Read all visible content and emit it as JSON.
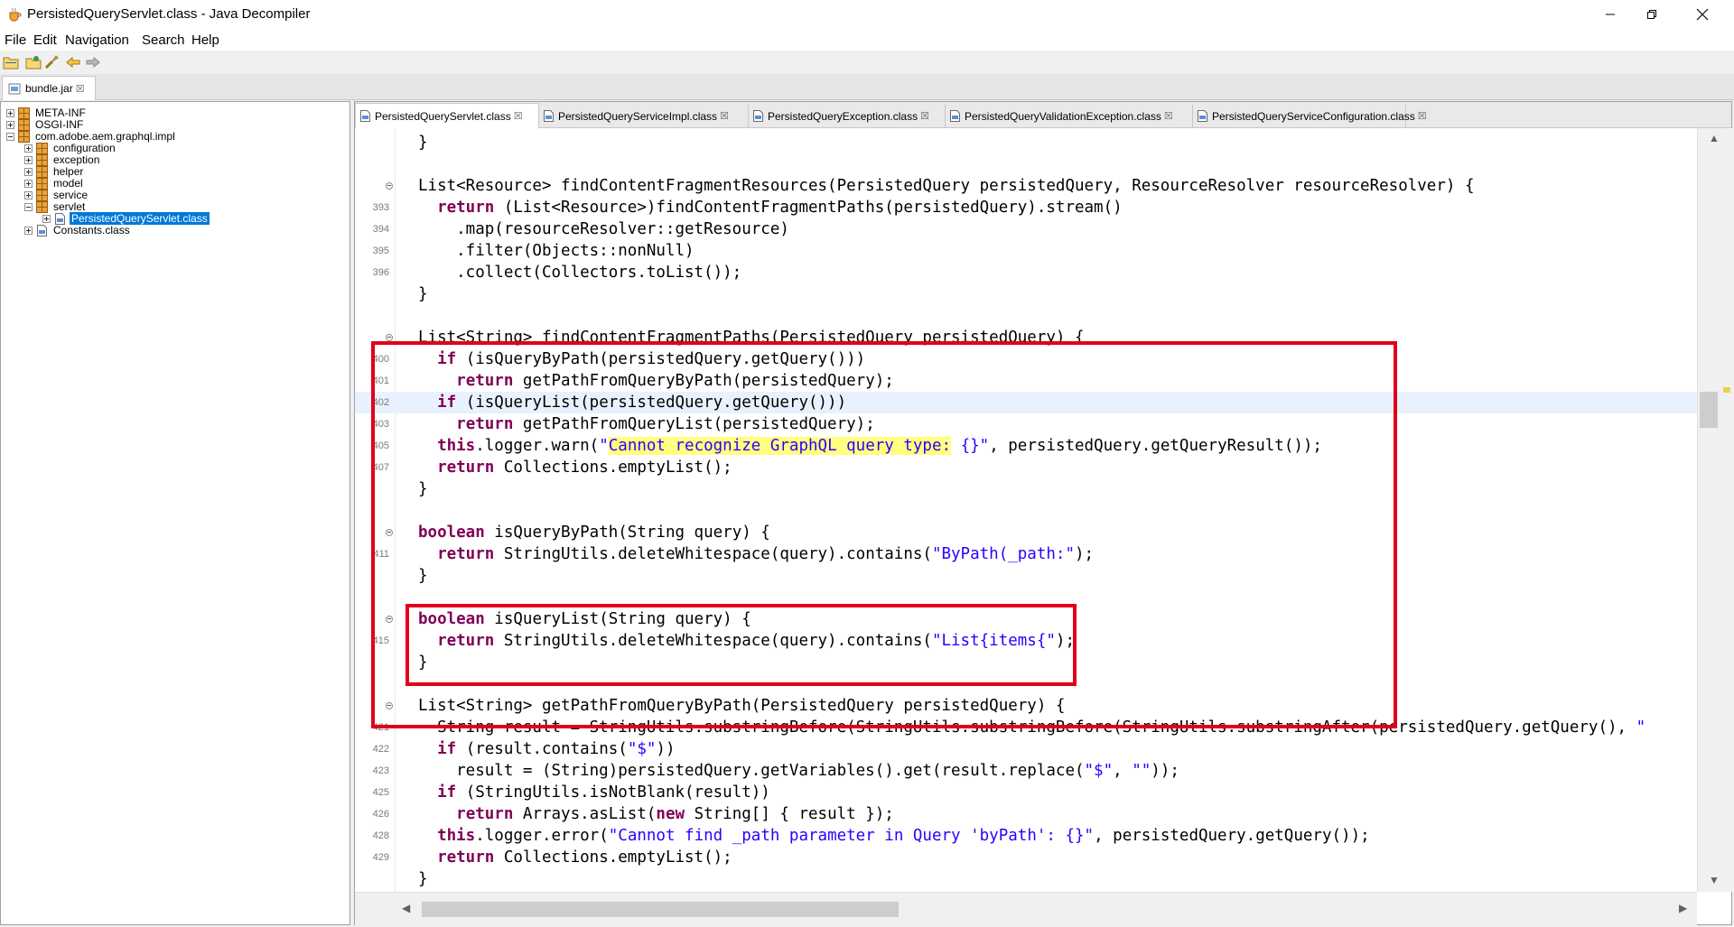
{
  "window": {
    "title": "PersistedQueryServlet.class - Java Decompiler",
    "controls": [
      "minimize",
      "restore",
      "close"
    ]
  },
  "menu": [
    "File",
    "Edit",
    "Navigation",
    "Search",
    "Help"
  ],
  "toolbar": [
    "open-file-icon",
    "open-type-icon",
    "search-icon",
    "back-icon",
    "forward-icon"
  ],
  "jar_tab": {
    "label": "bundle.jar",
    "close": "☒"
  },
  "tree": {
    "nodes": [
      {
        "label": "META-INF",
        "depth": 0,
        "icon": "package-icon",
        "expander": "plus",
        "selected": false
      },
      {
        "label": "OSGI-INF",
        "depth": 0,
        "icon": "package-icon",
        "expander": "plus",
        "selected": false
      },
      {
        "label": "com.adobe.aem.graphql.impl",
        "depth": 0,
        "icon": "package-icon",
        "expander": "minus",
        "selected": false
      },
      {
        "label": "configuration",
        "depth": 1,
        "icon": "package-icon",
        "expander": "plus",
        "selected": false
      },
      {
        "label": "exception",
        "depth": 1,
        "icon": "package-icon",
        "expander": "plus",
        "selected": false
      },
      {
        "label": "helper",
        "depth": 1,
        "icon": "package-icon",
        "expander": "plus",
        "selected": false
      },
      {
        "label": "model",
        "depth": 1,
        "icon": "package-icon",
        "expander": "plus",
        "selected": false
      },
      {
        "label": "service",
        "depth": 1,
        "icon": "package-icon",
        "expander": "plus",
        "selected": false
      },
      {
        "label": "servlet",
        "depth": 1,
        "icon": "package-icon",
        "expander": "minus",
        "selected": false
      },
      {
        "label": "PersistedQueryServlet.class",
        "depth": 2,
        "icon": "class-file-icon",
        "expander": "plus",
        "selected": true
      },
      {
        "label": "Constants.class",
        "depth": 1,
        "icon": "class-file-icon",
        "expander": "plus",
        "selected": false
      }
    ]
  },
  "editor_tabs": [
    {
      "label": "PersistedQueryServlet.class",
      "active": true
    },
    {
      "label": "PersistedQueryServiceImpl.class",
      "active": false
    },
    {
      "label": "PersistedQueryException.class",
      "active": false
    },
    {
      "label": "PersistedQueryValidationException.class",
      "active": false
    },
    {
      "label": "PersistedQueryServiceConfiguration.class",
      "active": false
    }
  ],
  "tab_close": "☒",
  "code": [
    {
      "n": "",
      "fold": false,
      "hl": false,
      "segs": [
        [
          "p",
          "}"
        ]
      ]
    },
    {
      "n": "",
      "fold": false,
      "hl": false,
      "segs": [
        [
          "p",
          ""
        ]
      ]
    },
    {
      "n": "",
      "fold": true,
      "hl": false,
      "segs": [
        [
          "p",
          "List<Resource> findContentFragmentResources(PersistedQuery persistedQuery, ResourceResolver resourceResolver) {"
        ]
      ]
    },
    {
      "n": "393",
      "fold": false,
      "hl": false,
      "segs": [
        [
          "p",
          "  "
        ],
        [
          "k",
          "return"
        ],
        [
          "p",
          " (List<Resource>)findContentFragmentPaths(persistedQuery).stream()"
        ]
      ]
    },
    {
      "n": "394",
      "fold": false,
      "hl": false,
      "segs": [
        [
          "p",
          "    .map(resourceResolver::getResource)"
        ]
      ]
    },
    {
      "n": "395",
      "fold": false,
      "hl": false,
      "segs": [
        [
          "p",
          "    .filter(Objects::nonNull)"
        ]
      ]
    },
    {
      "n": "396",
      "fold": false,
      "hl": false,
      "segs": [
        [
          "p",
          "    .collect(Collectors.toList());"
        ]
      ]
    },
    {
      "n": "",
      "fold": false,
      "hl": false,
      "segs": [
        [
          "p",
          "}"
        ]
      ]
    },
    {
      "n": "",
      "fold": false,
      "hl": false,
      "segs": [
        [
          "p",
          ""
        ]
      ]
    },
    {
      "n": "",
      "fold": true,
      "hl": false,
      "segs": [
        [
          "p",
          "List<String> findContentFragmentPaths(PersistedQuery persistedQuery) {"
        ]
      ]
    },
    {
      "n": "400",
      "fold": false,
      "hl": false,
      "segs": [
        [
          "p",
          "  "
        ],
        [
          "k",
          "if"
        ],
        [
          "p",
          " (isQueryByPath(persistedQuery.getQuery()))"
        ]
      ]
    },
    {
      "n": "401",
      "fold": false,
      "hl": false,
      "segs": [
        [
          "p",
          "    "
        ],
        [
          "k",
          "return"
        ],
        [
          "p",
          " getPathFromQueryByPath(persistedQuery);"
        ]
      ]
    },
    {
      "n": "402",
      "fold": false,
      "hl": true,
      "segs": [
        [
          "p",
          "  "
        ],
        [
          "k",
          "if"
        ],
        [
          "p",
          " (isQueryList(persistedQuery.getQuery()))"
        ]
      ]
    },
    {
      "n": "403",
      "fold": false,
      "hl": false,
      "segs": [
        [
          "p",
          "    "
        ],
        [
          "k",
          "return"
        ],
        [
          "p",
          " getPathFromQueryList(persistedQuery);"
        ]
      ]
    },
    {
      "n": "405",
      "fold": false,
      "hl": false,
      "segs": [
        [
          "p",
          "  "
        ],
        [
          "k",
          "this"
        ],
        [
          "p",
          ".logger.warn("
        ],
        [
          "s",
          "\""
        ],
        [
          "y",
          "Cannot recognize GraphQL query type:"
        ],
        [
          "s",
          " {}\""
        ],
        [
          "p",
          ", persistedQuery.getQueryResult());"
        ]
      ]
    },
    {
      "n": "407",
      "fold": false,
      "hl": false,
      "segs": [
        [
          "p",
          "  "
        ],
        [
          "k",
          "return"
        ],
        [
          "p",
          " Collections.emptyList();"
        ]
      ]
    },
    {
      "n": "",
      "fold": false,
      "hl": false,
      "segs": [
        [
          "p",
          "}"
        ]
      ]
    },
    {
      "n": "",
      "fold": false,
      "hl": false,
      "segs": [
        [
          "p",
          ""
        ]
      ]
    },
    {
      "n": "",
      "fold": true,
      "hl": false,
      "segs": [
        [
          "k",
          "boolean"
        ],
        [
          "p",
          " isQueryByPath(String query) {"
        ]
      ]
    },
    {
      "n": "411",
      "fold": false,
      "hl": false,
      "segs": [
        [
          "p",
          "  "
        ],
        [
          "k",
          "return"
        ],
        [
          "p",
          " StringUtils.deleteWhitespace(query).contains("
        ],
        [
          "s",
          "\"ByPath(_path:\""
        ],
        [
          "p",
          ");"
        ]
      ]
    },
    {
      "n": "",
      "fold": false,
      "hl": false,
      "segs": [
        [
          "p",
          "}"
        ]
      ]
    },
    {
      "n": "",
      "fold": false,
      "hl": false,
      "segs": [
        [
          "p",
          ""
        ]
      ]
    },
    {
      "n": "",
      "fold": true,
      "hl": false,
      "segs": [
        [
          "k",
          "boolean"
        ],
        [
          "p",
          " isQueryList(String query) {"
        ]
      ]
    },
    {
      "n": "415",
      "fold": false,
      "hl": false,
      "segs": [
        [
          "p",
          "  "
        ],
        [
          "k",
          "return"
        ],
        [
          "p",
          " StringUtils.deleteWhitespace(query).contains("
        ],
        [
          "s",
          "\"List{items{\""
        ],
        [
          "p",
          ");"
        ]
      ]
    },
    {
      "n": "",
      "fold": false,
      "hl": false,
      "segs": [
        [
          "p",
          "}"
        ]
      ]
    },
    {
      "n": "",
      "fold": false,
      "hl": false,
      "segs": [
        [
          "p",
          ""
        ]
      ]
    },
    {
      "n": "",
      "fold": true,
      "hl": false,
      "segs": [
        [
          "p",
          "List<String> getPathFromQueryByPath(PersistedQuery persistedQuery) {"
        ]
      ]
    },
    {
      "n": "421",
      "fold": false,
      "hl": false,
      "segs": [
        [
          "p",
          "  String result = StringUtils.substringBefore(StringUtils.substringBefore(StringUtils.substringAfter(persistedQuery.getQuery(), "
        ],
        [
          "s",
          "\""
        ]
      ]
    },
    {
      "n": "422",
      "fold": false,
      "hl": false,
      "segs": [
        [
          "p",
          "  "
        ],
        [
          "k",
          "if"
        ],
        [
          "p",
          " (result.contains("
        ],
        [
          "s",
          "\"$\""
        ],
        [
          "p",
          "))"
        ]
      ]
    },
    {
      "n": "423",
      "fold": false,
      "hl": false,
      "segs": [
        [
          "p",
          "    result = (String)persistedQuery.getVariables().get(result.replace("
        ],
        [
          "s",
          "\"$\""
        ],
        [
          "p",
          ", "
        ],
        [
          "s",
          "\"\""
        ],
        [
          "p",
          "));"
        ]
      ]
    },
    {
      "n": "425",
      "fold": false,
      "hl": false,
      "segs": [
        [
          "p",
          "  "
        ],
        [
          "k",
          "if"
        ],
        [
          "p",
          " (StringUtils.isNotBlank(result))"
        ]
      ]
    },
    {
      "n": "426",
      "fold": false,
      "hl": false,
      "segs": [
        [
          "p",
          "    "
        ],
        [
          "k",
          "return"
        ],
        [
          "p",
          " Arrays.asList("
        ],
        [
          "k",
          "new"
        ],
        [
          "p",
          " String[] { result });"
        ]
      ]
    },
    {
      "n": "428",
      "fold": false,
      "hl": false,
      "segs": [
        [
          "p",
          "  "
        ],
        [
          "k",
          "this"
        ],
        [
          "p",
          ".logger.error("
        ],
        [
          "s",
          "\"Cannot find _path parameter in Query 'byPath': {}\""
        ],
        [
          "p",
          ", persistedQuery.getQuery());"
        ]
      ]
    },
    {
      "n": "429",
      "fold": false,
      "hl": false,
      "segs": [
        [
          "p",
          "  "
        ],
        [
          "k",
          "return"
        ],
        [
          "p",
          " Collections.emptyList();"
        ]
      ]
    },
    {
      "n": "",
      "fold": false,
      "hl": false,
      "segs": [
        [
          "p",
          "}"
        ]
      ]
    }
  ],
  "colors": {
    "keyword": "#7f0055",
    "string": "#2a00ff",
    "search_highlight": "#ffff80",
    "annotation_box": "#e0001b",
    "selection": "#0078d7",
    "current_line": "#e8f2fe"
  }
}
